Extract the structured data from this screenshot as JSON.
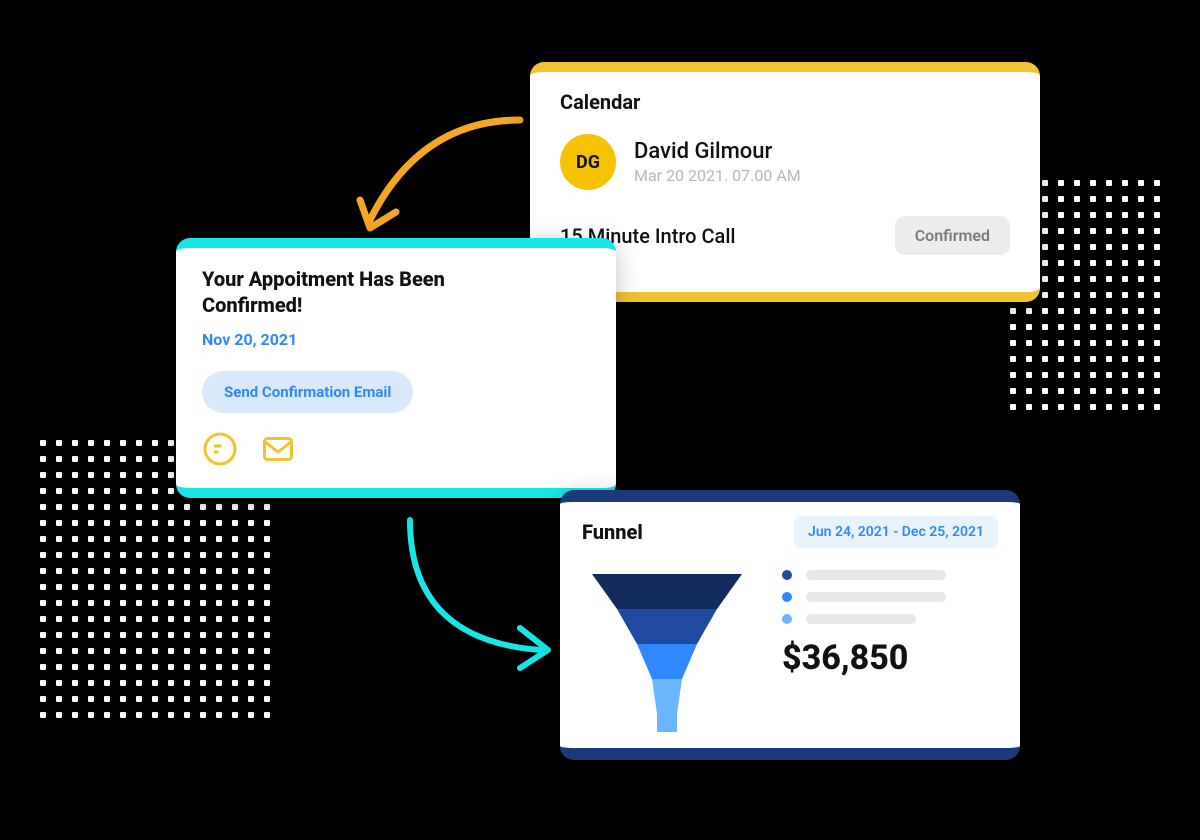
{
  "calendar": {
    "title": "Calendar",
    "avatar_initials": "DG",
    "person_name": "David Gilmour",
    "person_time": "Mar 20 2021. 07.00 AM",
    "call_type": "15 Minute Intro Call",
    "status": "Confirmed"
  },
  "appointment": {
    "title": "Your Appoitment Has Been Confirmed!",
    "date": "Nov 20, 2021",
    "button_label": "Send Confirmation Email"
  },
  "funnel": {
    "title": "Funnel",
    "date_range": "Jun 24, 2021 -  Dec 25, 2021",
    "value": "$36,850"
  },
  "colors": {
    "yellow": "#f1c232",
    "cyan": "#16e6e6",
    "blue": "#2f88ff",
    "navy": "#1a3a7a",
    "funnel1": "#122a5c",
    "funnel2": "#1e4aa0",
    "funnel3": "#2f88ff",
    "funnel4": "#6bb7ff"
  },
  "chart_data": {
    "type": "funnel",
    "title": "Funnel",
    "date_range": "Jun 24, 2021 - Dec 25, 2021",
    "stages": [
      {
        "color": "#122a5c"
      },
      {
        "color": "#1e4aa0"
      },
      {
        "color": "#2f88ff"
      },
      {
        "color": "#6bb7ff"
      }
    ],
    "total_value": "$36,850"
  }
}
